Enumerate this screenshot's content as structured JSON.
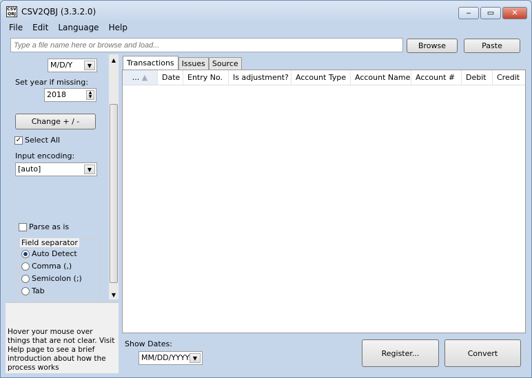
{
  "window": {
    "title": "CSV2QBJ (3.3.2.0)",
    "icon_text": "CSV QBJ",
    "minimize": "‒",
    "maximize": "▭",
    "close": "✕"
  },
  "menu": [
    "File",
    "Edit",
    "Language",
    "Help"
  ],
  "file_input": {
    "placeholder": "Type a file name here or browse and load..."
  },
  "buttons": {
    "browse": "Browse",
    "paste": "Paste",
    "change": "Change + / -",
    "register": "Register...",
    "convert": "Convert"
  },
  "left": {
    "date_format": "M/D/Y",
    "year_label": "Set year if missing:",
    "year_value": "2018",
    "select_all": "Select All",
    "select_all_checked": true,
    "encoding_label": "Input encoding:",
    "encoding_value": "[auto]",
    "parse_as_is": "Parse as is",
    "parse_as_is_checked": false,
    "separator_label": "Field separator",
    "separators": [
      "Auto Detect",
      "Comma (,)",
      "Semicolon (;)",
      "Tab"
    ],
    "separator_selected": "Auto Detect",
    "help_text": "Hover your mouse over things that are not clear. Visit Help page to see a brief introduction about how the process works"
  },
  "tabs": [
    "Transactions",
    "Issues",
    "Source"
  ],
  "active_tab": "Transactions",
  "columns": [
    "...",
    "Date",
    "Entry No.",
    "Is adjustment?",
    "Account Type",
    "Account Name",
    "Account #",
    "Debit",
    "Credit"
  ],
  "show_dates": {
    "label": "Show Dates:",
    "value": "MM/DD/YYYY"
  }
}
